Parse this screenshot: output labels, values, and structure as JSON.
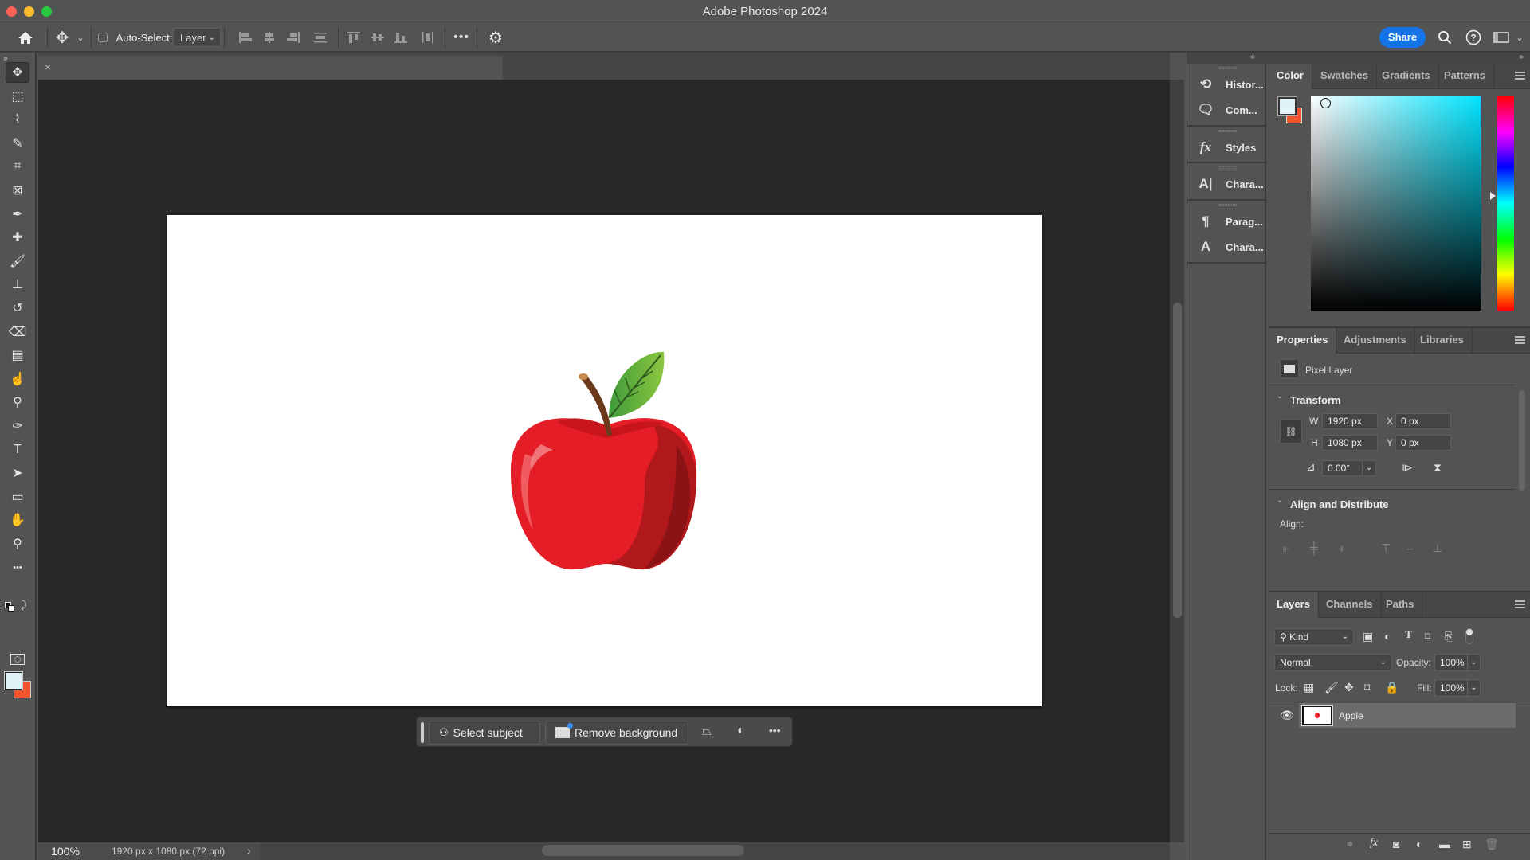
{
  "window": {
    "title": "Adobe Photoshop 2024"
  },
  "options_bar": {
    "home_icon": "home-icon",
    "move_tool_icon": "move-icon",
    "auto_select_label": "Auto-Select:",
    "auto_select_checked": false,
    "auto_select_target": "Layer",
    "align_icons": [
      "align-left-edges",
      "align-horizontal-centers",
      "align-right-edges",
      "distribute-vertical",
      "align-top-edges",
      "align-vertical-centers",
      "align-bottom-edges",
      "distribute-horizontal"
    ],
    "more_icon": "more-icon",
    "settings_icon": "gear-icon",
    "share_label": "Share",
    "right_icons": [
      "search-icon",
      "help-icon",
      "workspace-icon"
    ]
  },
  "tools": [
    {
      "name": "move-tool",
      "glyph": "✥",
      "active": true
    },
    {
      "name": "rectangular-marquee-tool",
      "glyph": "⬚"
    },
    {
      "name": "lasso-tool",
      "glyph": "⌇"
    },
    {
      "name": "quick-selection-tool",
      "glyph": "✎"
    },
    {
      "name": "crop-tool",
      "glyph": "⌗"
    },
    {
      "name": "frame-tool",
      "glyph": "⊠"
    },
    {
      "name": "eyedropper-tool",
      "glyph": "✒"
    },
    {
      "name": "spot-healing-brush-tool",
      "glyph": "✚"
    },
    {
      "name": "brush-tool",
      "glyph": "🖌"
    },
    {
      "name": "clone-stamp-tool",
      "glyph": "⊥"
    },
    {
      "name": "history-brush-tool",
      "glyph": "↺"
    },
    {
      "name": "eraser-tool",
      "glyph": "⌫"
    },
    {
      "name": "gradient-tool",
      "glyph": "▤"
    },
    {
      "name": "smudge-tool",
      "glyph": "☝"
    },
    {
      "name": "dodge-tool",
      "glyph": "⚲"
    },
    {
      "name": "pen-tool",
      "glyph": "✑"
    },
    {
      "name": "type-tool",
      "glyph": "T"
    },
    {
      "name": "path-selection-tool",
      "glyph": "➤"
    },
    {
      "name": "rectangle-tool",
      "glyph": "▭"
    },
    {
      "name": "hand-tool",
      "glyph": "✋"
    },
    {
      "name": "zoom-tool",
      "glyph": "⚲"
    },
    {
      "name": "edit-toolbar",
      "glyph": "•••"
    }
  ],
  "colors": {
    "foreground": "#e2f3f7",
    "background": "#f2542d",
    "accent": "#1473e6"
  },
  "document": {
    "tab_close": "×",
    "zoom": "100%",
    "info": "1920 px x 1080 px (72 ppi)",
    "info_arrow": "›"
  },
  "context_bar": {
    "select_subject": "Select subject",
    "remove_background": "Remove background"
  },
  "icon_panel": {
    "items": [
      {
        "label": "Histor...",
        "icon": "history-icon"
      },
      {
        "label": "Com...",
        "icon": "comments-icon"
      },
      {
        "label": "Styles",
        "icon": "styles-icon"
      },
      {
        "label": "Chara...",
        "icon": "character-icon"
      },
      {
        "label": "Parag...",
        "icon": "paragraph-styles-icon"
      },
      {
        "label": "Chara...",
        "icon": "character-styles-icon"
      }
    ]
  },
  "color_panel": {
    "tabs": [
      "Color",
      "Swatches",
      "Gradients",
      "Patterns"
    ],
    "active_tab": "Color",
    "hue_color": "#00e5ff"
  },
  "properties_panel": {
    "tabs": [
      "Properties",
      "Adjustments",
      "Libraries"
    ],
    "active_tab": "Properties",
    "layer_type": "Pixel Layer",
    "transform_title": "Transform",
    "w_label": "W",
    "w_value": "1920 px",
    "h_label": "H",
    "h_value": "1080 px",
    "x_label": "X",
    "x_value": "0 px",
    "y_label": "Y",
    "y_value": "0 px",
    "angle_value": "0.00°",
    "align_title": "Align and Distribute",
    "align_label": "Align:"
  },
  "layers_panel": {
    "tabs": [
      "Layers",
      "Channels",
      "Paths"
    ],
    "active_tab": "Layers",
    "filter_kind": "Kind",
    "blend_mode": "Normal",
    "opacity_label": "Opacity:",
    "opacity_value": "100%",
    "lock_label": "Lock:",
    "fill_label": "Fill:",
    "fill_value": "100%",
    "layers": [
      {
        "name": "Apple",
        "visible": true,
        "selected": true
      }
    ]
  }
}
